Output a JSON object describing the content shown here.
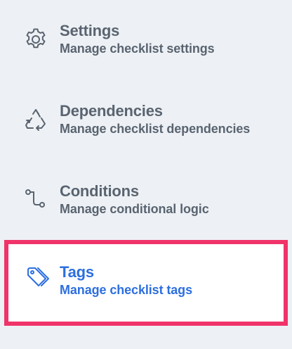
{
  "menu": {
    "items": [
      {
        "id": "settings",
        "title": "Settings",
        "subtitle": "Manage checklist settings",
        "icon": "gear-icon",
        "selected": false
      },
      {
        "id": "dependencies",
        "title": "Dependencies",
        "subtitle": "Manage checklist dependencies",
        "icon": "recycle-icon",
        "selected": false
      },
      {
        "id": "conditions",
        "title": "Conditions",
        "subtitle": "Manage conditional logic",
        "icon": "branch-icon",
        "selected": false
      },
      {
        "id": "tags",
        "title": "Tags",
        "subtitle": "Manage checklist tags",
        "icon": "tag-icon",
        "selected": true
      }
    ]
  },
  "colors": {
    "background": "#edf1f5",
    "text": "#5a6470",
    "selected_text": "#2d6fe0",
    "selected_background": "#ffffff",
    "highlight_border": "#f0346a"
  }
}
